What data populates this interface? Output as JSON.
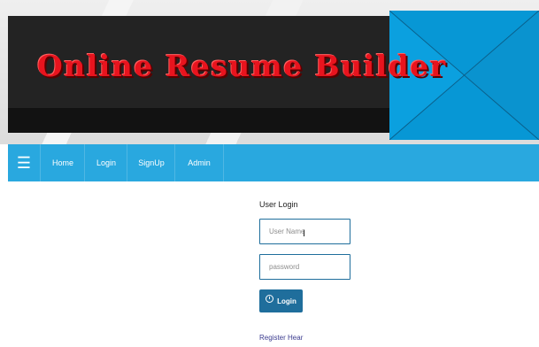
{
  "banner": {
    "title": "Online Resume Builder",
    "title_color": "#e8141e",
    "accent_color": "#0797d5"
  },
  "navbar": {
    "menu_icon": "hamburger-menu-icon",
    "background": "#29a8df",
    "items": [
      {
        "label": "Home"
      },
      {
        "label": "Login"
      },
      {
        "label": "SignUp"
      },
      {
        "label": "Admin"
      }
    ]
  },
  "login": {
    "heading": "User Login",
    "username_placeholder": "User Name",
    "password_placeholder": "password",
    "button_label": "Login",
    "button_icon": "power-icon",
    "register_link": "Register Hear"
  }
}
